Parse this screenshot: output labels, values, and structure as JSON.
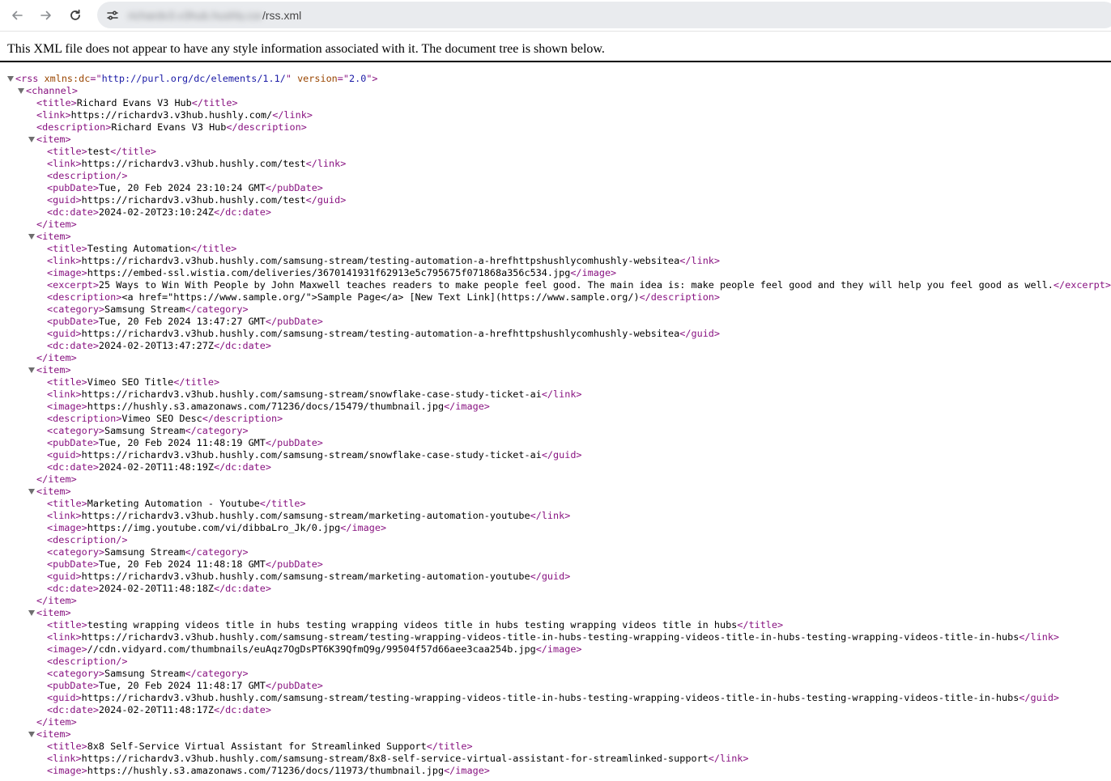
{
  "browser": {
    "url_host": "richardv3.v3hub.hushly.com",
    "url_path": "/rss.xml"
  },
  "xml_info": "This XML file does not appear to have any style information associated with it. The document tree is shown below.",
  "xml_lines": [
    {
      "indent": 0,
      "toggle": true,
      "parts": [
        {
          "t": "tag",
          "v": "<rss "
        },
        {
          "t": "attr",
          "v": "xmlns:dc"
        },
        {
          "t": "tag",
          "v": "=\""
        },
        {
          "t": "val",
          "v": "http://purl.org/dc/elements/1.1/"
        },
        {
          "t": "tag",
          "v": "\" "
        },
        {
          "t": "attr",
          "v": "version"
        },
        {
          "t": "tag",
          "v": "=\""
        },
        {
          "t": "val",
          "v": "2.0"
        },
        {
          "t": "tag",
          "v": "\">"
        }
      ]
    },
    {
      "indent": 1,
      "toggle": true,
      "parts": [
        {
          "t": "tag",
          "v": "<channel>"
        }
      ]
    },
    {
      "indent": 2,
      "toggle": false,
      "parts": [
        {
          "t": "tag",
          "v": "<title>"
        },
        {
          "t": "txt",
          "v": "Richard Evans V3 Hub"
        },
        {
          "t": "tag",
          "v": "</title>"
        }
      ]
    },
    {
      "indent": 2,
      "toggle": false,
      "parts": [
        {
          "t": "tag",
          "v": "<link>"
        },
        {
          "t": "txt",
          "v": "https://richardv3.v3hub.hushly.com/"
        },
        {
          "t": "tag",
          "v": "</link>"
        }
      ]
    },
    {
      "indent": 2,
      "toggle": false,
      "parts": [
        {
          "t": "tag",
          "v": "<description>"
        },
        {
          "t": "txt",
          "v": "Richard Evans V3 Hub"
        },
        {
          "t": "tag",
          "v": "</description>"
        }
      ]
    },
    {
      "indent": 2,
      "toggle": true,
      "parts": [
        {
          "t": "tag",
          "v": "<item>"
        }
      ]
    },
    {
      "indent": 3,
      "toggle": false,
      "parts": [
        {
          "t": "tag",
          "v": "<title>"
        },
        {
          "t": "txt",
          "v": "test"
        },
        {
          "t": "tag",
          "v": "</title>"
        }
      ]
    },
    {
      "indent": 3,
      "toggle": false,
      "parts": [
        {
          "t": "tag",
          "v": "<link>"
        },
        {
          "t": "txt",
          "v": "https://richardv3.v3hub.hushly.com/test"
        },
        {
          "t": "tag",
          "v": "</link>"
        }
      ]
    },
    {
      "indent": 3,
      "toggle": false,
      "parts": [
        {
          "t": "tag",
          "v": "<description/>"
        }
      ]
    },
    {
      "indent": 3,
      "toggle": false,
      "parts": [
        {
          "t": "tag",
          "v": "<pubDate>"
        },
        {
          "t": "txt",
          "v": "Tue, 20 Feb 2024 23:10:24 GMT"
        },
        {
          "t": "tag",
          "v": "</pubDate>"
        }
      ]
    },
    {
      "indent": 3,
      "toggle": false,
      "parts": [
        {
          "t": "tag",
          "v": "<guid>"
        },
        {
          "t": "txt",
          "v": "https://richardv3.v3hub.hushly.com/test"
        },
        {
          "t": "tag",
          "v": "</guid>"
        }
      ]
    },
    {
      "indent": 3,
      "toggle": false,
      "parts": [
        {
          "t": "tag",
          "v": "<dc:date>"
        },
        {
          "t": "txt",
          "v": "2024-02-20T23:10:24Z"
        },
        {
          "t": "tag",
          "v": "</dc:date>"
        }
      ]
    },
    {
      "indent": 2,
      "toggle": false,
      "parts": [
        {
          "t": "tag",
          "v": "</item>"
        }
      ]
    },
    {
      "indent": 2,
      "toggle": true,
      "parts": [
        {
          "t": "tag",
          "v": "<item>"
        }
      ]
    },
    {
      "indent": 3,
      "toggle": false,
      "parts": [
        {
          "t": "tag",
          "v": "<title>"
        },
        {
          "t": "txt",
          "v": "Testing Automation"
        },
        {
          "t": "tag",
          "v": "</title>"
        }
      ]
    },
    {
      "indent": 3,
      "toggle": false,
      "parts": [
        {
          "t": "tag",
          "v": "<link>"
        },
        {
          "t": "txt",
          "v": "https://richardv3.v3hub.hushly.com/samsung-stream/testing-automation-a-hrefhttpshushlycomhushly-websitea"
        },
        {
          "t": "tag",
          "v": "</link>"
        }
      ]
    },
    {
      "indent": 3,
      "toggle": false,
      "parts": [
        {
          "t": "tag",
          "v": "<image>"
        },
        {
          "t": "txt",
          "v": "https://embed-ssl.wistia.com/deliveries/3670141931f62913e5c795675f071868a356c534.jpg"
        },
        {
          "t": "tag",
          "v": "</image>"
        }
      ]
    },
    {
      "indent": 3,
      "toggle": false,
      "parts": [
        {
          "t": "tag",
          "v": "<excerpt>"
        },
        {
          "t": "txt",
          "v": "25 Ways to Win With People by John Maxwell teaches readers to make people feel good. The main idea is: make people feel good and they will help you feel good as well."
        },
        {
          "t": "tag",
          "v": "</excerpt>"
        }
      ]
    },
    {
      "indent": 3,
      "toggle": false,
      "parts": [
        {
          "t": "tag",
          "v": "<description>"
        },
        {
          "t": "txt",
          "v": "<a href=\"https://www.sample.org/\">Sample Page</a> [New Text Link](https://www.sample.org/)"
        },
        {
          "t": "tag",
          "v": "</description>"
        }
      ]
    },
    {
      "indent": 3,
      "toggle": false,
      "parts": [
        {
          "t": "tag",
          "v": "<category>"
        },
        {
          "t": "txt",
          "v": "Samsung Stream"
        },
        {
          "t": "tag",
          "v": "</category>"
        }
      ]
    },
    {
      "indent": 3,
      "toggle": false,
      "parts": [
        {
          "t": "tag",
          "v": "<pubDate>"
        },
        {
          "t": "txt",
          "v": "Tue, 20 Feb 2024 13:47:27 GMT"
        },
        {
          "t": "tag",
          "v": "</pubDate>"
        }
      ]
    },
    {
      "indent": 3,
      "toggle": false,
      "parts": [
        {
          "t": "tag",
          "v": "<guid>"
        },
        {
          "t": "txt",
          "v": "https://richardv3.v3hub.hushly.com/samsung-stream/testing-automation-a-hrefhttpshushlycomhushly-websitea"
        },
        {
          "t": "tag",
          "v": "</guid>"
        }
      ]
    },
    {
      "indent": 3,
      "toggle": false,
      "parts": [
        {
          "t": "tag",
          "v": "<dc:date>"
        },
        {
          "t": "txt",
          "v": "2024-02-20T13:47:27Z"
        },
        {
          "t": "tag",
          "v": "</dc:date>"
        }
      ]
    },
    {
      "indent": 2,
      "toggle": false,
      "parts": [
        {
          "t": "tag",
          "v": "</item>"
        }
      ]
    },
    {
      "indent": 2,
      "toggle": true,
      "parts": [
        {
          "t": "tag",
          "v": "<item>"
        }
      ]
    },
    {
      "indent": 3,
      "toggle": false,
      "parts": [
        {
          "t": "tag",
          "v": "<title>"
        },
        {
          "t": "txt",
          "v": "Vimeo SEO Title"
        },
        {
          "t": "tag",
          "v": "</title>"
        }
      ]
    },
    {
      "indent": 3,
      "toggle": false,
      "parts": [
        {
          "t": "tag",
          "v": "<link>"
        },
        {
          "t": "txt",
          "v": "https://richardv3.v3hub.hushly.com/samsung-stream/snowflake-case-study-ticket-ai"
        },
        {
          "t": "tag",
          "v": "</link>"
        }
      ]
    },
    {
      "indent": 3,
      "toggle": false,
      "parts": [
        {
          "t": "tag",
          "v": "<image>"
        },
        {
          "t": "txt",
          "v": "https://hushly.s3.amazonaws.com/71236/docs/15479/thumbnail.jpg"
        },
        {
          "t": "tag",
          "v": "</image>"
        }
      ]
    },
    {
      "indent": 3,
      "toggle": false,
      "parts": [
        {
          "t": "tag",
          "v": "<description>"
        },
        {
          "t": "txt",
          "v": "Vimeo SEO Desc"
        },
        {
          "t": "tag",
          "v": "</description>"
        }
      ]
    },
    {
      "indent": 3,
      "toggle": false,
      "parts": [
        {
          "t": "tag",
          "v": "<category>"
        },
        {
          "t": "txt",
          "v": "Samsung Stream"
        },
        {
          "t": "tag",
          "v": "</category>"
        }
      ]
    },
    {
      "indent": 3,
      "toggle": false,
      "parts": [
        {
          "t": "tag",
          "v": "<pubDate>"
        },
        {
          "t": "txt",
          "v": "Tue, 20 Feb 2024 11:48:19 GMT"
        },
        {
          "t": "tag",
          "v": "</pubDate>"
        }
      ]
    },
    {
      "indent": 3,
      "toggle": false,
      "parts": [
        {
          "t": "tag",
          "v": "<guid>"
        },
        {
          "t": "txt",
          "v": "https://richardv3.v3hub.hushly.com/samsung-stream/snowflake-case-study-ticket-ai"
        },
        {
          "t": "tag",
          "v": "</guid>"
        }
      ]
    },
    {
      "indent": 3,
      "toggle": false,
      "parts": [
        {
          "t": "tag",
          "v": "<dc:date>"
        },
        {
          "t": "txt",
          "v": "2024-02-20T11:48:19Z"
        },
        {
          "t": "tag",
          "v": "</dc:date>"
        }
      ]
    },
    {
      "indent": 2,
      "toggle": false,
      "parts": [
        {
          "t": "tag",
          "v": "</item>"
        }
      ]
    },
    {
      "indent": 2,
      "toggle": true,
      "parts": [
        {
          "t": "tag",
          "v": "<item>"
        }
      ]
    },
    {
      "indent": 3,
      "toggle": false,
      "parts": [
        {
          "t": "tag",
          "v": "<title>"
        },
        {
          "t": "txt",
          "v": "Marketing Automation - Youtube"
        },
        {
          "t": "tag",
          "v": "</title>"
        }
      ]
    },
    {
      "indent": 3,
      "toggle": false,
      "parts": [
        {
          "t": "tag",
          "v": "<link>"
        },
        {
          "t": "txt",
          "v": "https://richardv3.v3hub.hushly.com/samsung-stream/marketing-automation-youtube"
        },
        {
          "t": "tag",
          "v": "</link>"
        }
      ]
    },
    {
      "indent": 3,
      "toggle": false,
      "parts": [
        {
          "t": "tag",
          "v": "<image>"
        },
        {
          "t": "txt",
          "v": "https://img.youtube.com/vi/dibbaLro_Jk/0.jpg"
        },
        {
          "t": "tag",
          "v": "</image>"
        }
      ]
    },
    {
      "indent": 3,
      "toggle": false,
      "parts": [
        {
          "t": "tag",
          "v": "<description/>"
        }
      ]
    },
    {
      "indent": 3,
      "toggle": false,
      "parts": [
        {
          "t": "tag",
          "v": "<category>"
        },
        {
          "t": "txt",
          "v": "Samsung Stream"
        },
        {
          "t": "tag",
          "v": "</category>"
        }
      ]
    },
    {
      "indent": 3,
      "toggle": false,
      "parts": [
        {
          "t": "tag",
          "v": "<pubDate>"
        },
        {
          "t": "txt",
          "v": "Tue, 20 Feb 2024 11:48:18 GMT"
        },
        {
          "t": "tag",
          "v": "</pubDate>"
        }
      ]
    },
    {
      "indent": 3,
      "toggle": false,
      "parts": [
        {
          "t": "tag",
          "v": "<guid>"
        },
        {
          "t": "txt",
          "v": "https://richardv3.v3hub.hushly.com/samsung-stream/marketing-automation-youtube"
        },
        {
          "t": "tag",
          "v": "</guid>"
        }
      ]
    },
    {
      "indent": 3,
      "toggle": false,
      "parts": [
        {
          "t": "tag",
          "v": "<dc:date>"
        },
        {
          "t": "txt",
          "v": "2024-02-20T11:48:18Z"
        },
        {
          "t": "tag",
          "v": "</dc:date>"
        }
      ]
    },
    {
      "indent": 2,
      "toggle": false,
      "parts": [
        {
          "t": "tag",
          "v": "</item>"
        }
      ]
    },
    {
      "indent": 2,
      "toggle": true,
      "parts": [
        {
          "t": "tag",
          "v": "<item>"
        }
      ]
    },
    {
      "indent": 3,
      "toggle": false,
      "parts": [
        {
          "t": "tag",
          "v": "<title>"
        },
        {
          "t": "txt",
          "v": "testing wrapping videos title in hubs testing wrapping videos title in hubs testing wrapping videos title in hubs"
        },
        {
          "t": "tag",
          "v": "</title>"
        }
      ]
    },
    {
      "indent": 3,
      "toggle": false,
      "parts": [
        {
          "t": "tag",
          "v": "<link>"
        },
        {
          "t": "txt",
          "v": "https://richardv3.v3hub.hushly.com/samsung-stream/testing-wrapping-videos-title-in-hubs-testing-wrapping-videos-title-in-hubs-testing-wrapping-videos-title-in-hubs"
        },
        {
          "t": "tag",
          "v": "</link>"
        }
      ]
    },
    {
      "indent": 3,
      "toggle": false,
      "parts": [
        {
          "t": "tag",
          "v": "<image>"
        },
        {
          "t": "txt",
          "v": "//cdn.vidyard.com/thumbnails/euAqz7OgDsPT6K39QfmQ9g/99504f57d66aee3caa254b.jpg"
        },
        {
          "t": "tag",
          "v": "</image>"
        }
      ]
    },
    {
      "indent": 3,
      "toggle": false,
      "parts": [
        {
          "t": "tag",
          "v": "<description/>"
        }
      ]
    },
    {
      "indent": 3,
      "toggle": false,
      "parts": [
        {
          "t": "tag",
          "v": "<category>"
        },
        {
          "t": "txt",
          "v": "Samsung Stream"
        },
        {
          "t": "tag",
          "v": "</category>"
        }
      ]
    },
    {
      "indent": 3,
      "toggle": false,
      "parts": [
        {
          "t": "tag",
          "v": "<pubDate>"
        },
        {
          "t": "txt",
          "v": "Tue, 20 Feb 2024 11:48:17 GMT"
        },
        {
          "t": "tag",
          "v": "</pubDate>"
        }
      ]
    },
    {
      "indent": 3,
      "toggle": false,
      "parts": [
        {
          "t": "tag",
          "v": "<guid>"
        },
        {
          "t": "txt",
          "v": "https://richardv3.v3hub.hushly.com/samsung-stream/testing-wrapping-videos-title-in-hubs-testing-wrapping-videos-title-in-hubs-testing-wrapping-videos-title-in-hubs"
        },
        {
          "t": "tag",
          "v": "</guid>"
        }
      ]
    },
    {
      "indent": 3,
      "toggle": false,
      "parts": [
        {
          "t": "tag",
          "v": "<dc:date>"
        },
        {
          "t": "txt",
          "v": "2024-02-20T11:48:17Z"
        },
        {
          "t": "tag",
          "v": "</dc:date>"
        }
      ]
    },
    {
      "indent": 2,
      "toggle": false,
      "parts": [
        {
          "t": "tag",
          "v": "</item>"
        }
      ]
    },
    {
      "indent": 2,
      "toggle": true,
      "parts": [
        {
          "t": "tag",
          "v": "<item>"
        }
      ]
    },
    {
      "indent": 3,
      "toggle": false,
      "parts": [
        {
          "t": "tag",
          "v": "<title>"
        },
        {
          "t": "txt",
          "v": "8x8 Self-Service Virtual Assistant for Streamlinked Support"
        },
        {
          "t": "tag",
          "v": "</title>"
        }
      ]
    },
    {
      "indent": 3,
      "toggle": false,
      "parts": [
        {
          "t": "tag",
          "v": "<link>"
        },
        {
          "t": "txt",
          "v": "https://richardv3.v3hub.hushly.com/samsung-stream/8x8-self-service-virtual-assistant-for-streamlinked-support"
        },
        {
          "t": "tag",
          "v": "</link>"
        }
      ]
    },
    {
      "indent": 3,
      "toggle": false,
      "parts": [
        {
          "t": "tag",
          "v": "<image>"
        },
        {
          "t": "txt",
          "v": "https://hushly.s3.amazonaws.com/71236/docs/11973/thumbnail.jpg"
        },
        {
          "t": "tag",
          "v": "</image>"
        }
      ]
    }
  ]
}
